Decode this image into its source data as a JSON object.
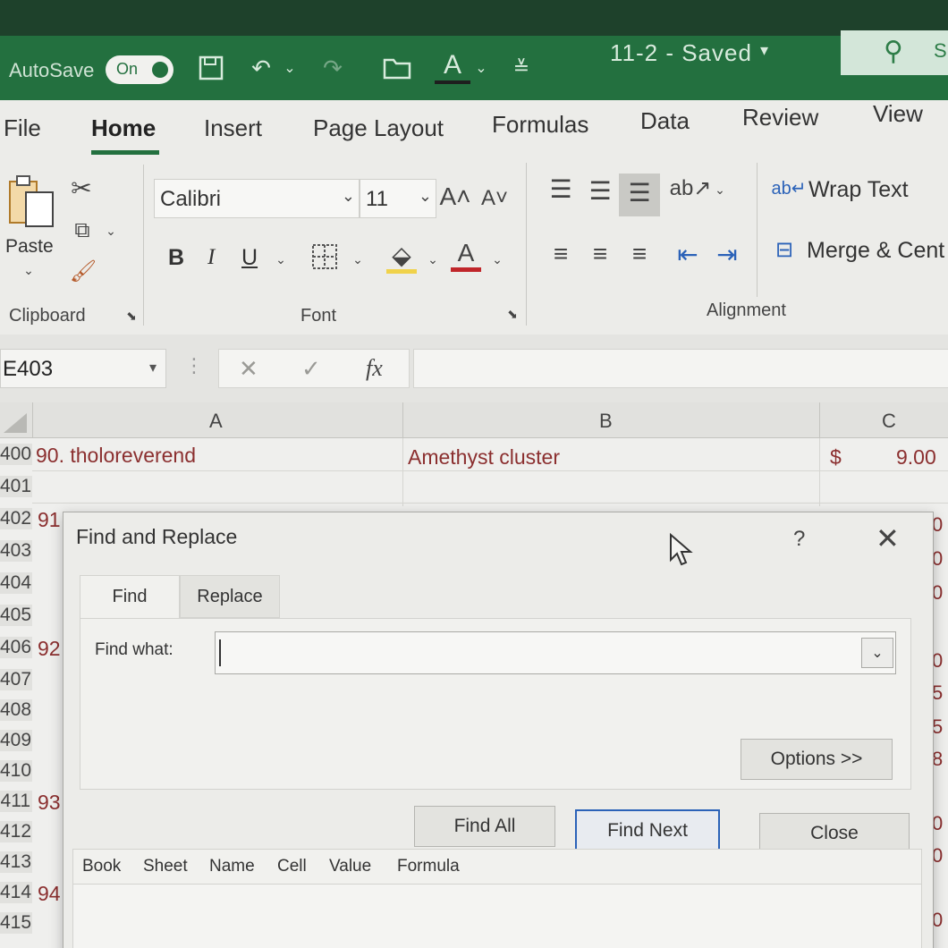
{
  "titlebar": {
    "autosave_label": "AutoSave",
    "autosave_state": "On",
    "document_title": "11-2 - Saved",
    "search_letter": "S"
  },
  "ribbon_tabs": [
    "File",
    "Home",
    "Insert",
    "Page Layout",
    "Formulas",
    "Data",
    "Review",
    "View"
  ],
  "active_tab": "Home",
  "clipboard": {
    "paste_label": "Paste",
    "group_label": "Clipboard"
  },
  "font": {
    "font_name": "Calibri",
    "font_size": "11",
    "bold": "B",
    "italic": "I",
    "underline": "U",
    "group_label": "Font"
  },
  "alignment": {
    "wrap_text": "Wrap Text",
    "merge_center": "Merge & Cent",
    "group_label": "Alignment"
  },
  "formula_bar": {
    "name_box": "E403",
    "fx": "fx",
    "formula_value": ""
  },
  "grid": {
    "columns": [
      "A",
      "B",
      "C"
    ],
    "row_numbers": [
      "400",
      "401",
      "402",
      "403",
      "404",
      "405",
      "406",
      "407",
      "408",
      "409",
      "410",
      "411",
      "412",
      "413",
      "414",
      "415"
    ],
    "row_400": {
      "a": "90. tholoreverend",
      "b": "Amethyst cluster",
      "c_currency": "$",
      "c_value": "9.00"
    },
    "partial_a": {
      "r402": "91",
      "r406": "92",
      "r411": "93",
      "r414": "94"
    },
    "right_edge_fragments": [
      "0",
      "0",
      "0",
      "0",
      "5",
      "5",
      "8",
      "0",
      "0",
      "0"
    ]
  },
  "dialog": {
    "title": "Find and Replace",
    "help": "?",
    "tabs": [
      "Find",
      "Replace"
    ],
    "active_tab": "Find",
    "find_what_label": "Find what:",
    "find_what_value": "",
    "options_button": "Options >>",
    "find_all_button": "Find All",
    "find_next_button": "Find Next",
    "close_button": "Close",
    "result_columns": [
      "Book",
      "Sheet",
      "Name",
      "Cell",
      "Value",
      "Formula"
    ]
  },
  "colors": {
    "title_green": "#23703f",
    "ribbon_bg": "#ecece9",
    "cell_text": "#8b2f2f",
    "focus_blue": "#2b62b8"
  }
}
